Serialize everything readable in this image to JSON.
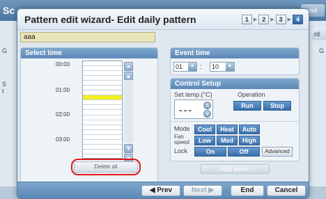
{
  "background": {
    "title": "Sc",
    "right_button": "put",
    "side_g": "G",
    "side_s": "S",
    "side_t": "t",
    "right_edge_button": "rd",
    "right_edge_g": "G"
  },
  "dialog": {
    "title": "Pattern edit wizard- Edit daily pattern",
    "steps": [
      "1",
      "2",
      "3",
      "4"
    ],
    "active_step": "4",
    "pattern_name": "aaa"
  },
  "select_time": {
    "heading": "Select time",
    "times": [
      "00:00",
      "01:00",
      "02:00",
      "03:00"
    ],
    "highlighted_row": 7,
    "delete_all": "Delete all"
  },
  "event_time": {
    "heading": "Event  time",
    "hour": "01",
    "minute": "10",
    "separator": ":"
  },
  "control_setup": {
    "heading": "Control Setup",
    "set_temp_label": "Set temp.(°C)",
    "temp_value": "---",
    "operation_label": "Operation",
    "run": "Run",
    "stop": "Stop",
    "mode_label": "Mode",
    "modes": [
      "Cool",
      "Heat",
      "Auto"
    ],
    "fan_label": "Fan\nspeed",
    "fan_label_1": "Fan",
    "fan_label_2": "speed",
    "fan_speeds": [
      "Low",
      "Med",
      "High"
    ],
    "lock_label": "Lock",
    "lock_on": "On",
    "lock_off": "Off",
    "advanced": "Advanced"
  },
  "add_event": "Add event",
  "footer": {
    "prev": "◀ Prev",
    "next": "Next ▶",
    "end": "End",
    "cancel": "Cancel"
  },
  "colors": {
    "highlight": "#f4ee22",
    "accent_blue": "#3a6ea8",
    "name_field": "#e9e4b9",
    "callout_red": "#e0181b"
  }
}
